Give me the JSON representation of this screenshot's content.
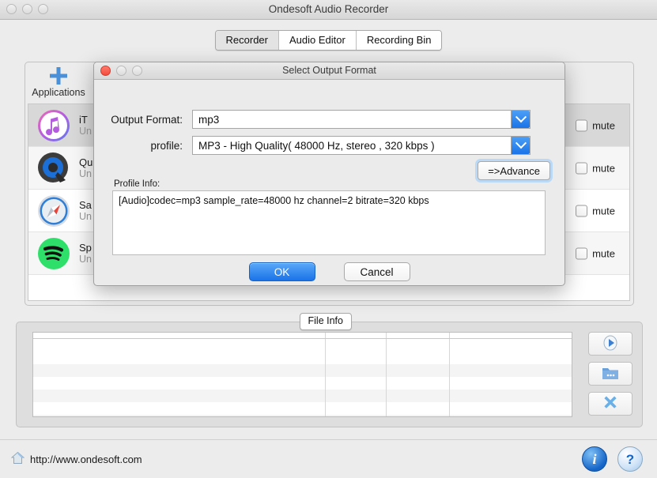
{
  "window": {
    "title": "Ondesoft Audio Recorder",
    "traffic_lights": [
      "close",
      "minimize",
      "zoom"
    ]
  },
  "tabs": [
    {
      "label": "Recorder",
      "selected": true
    },
    {
      "label": "Audio Editor",
      "selected": false
    },
    {
      "label": "Recording Bin",
      "selected": false
    }
  ],
  "toolbar": {
    "add": {
      "label": "Applications",
      "icon": "plus-icon"
    },
    "delete": {
      "label": "",
      "icon": "x-delete-icon"
    },
    "schedule": {
      "label": "",
      "icon": "clock-icon"
    }
  },
  "app_list": {
    "mute_label": "mute",
    "rows": [
      {
        "name": "iT",
        "status": "Un",
        "icon": "itunes-icon",
        "muted": false,
        "selected": true
      },
      {
        "name": "Qu",
        "status": "Un",
        "icon": "quicktime-icon",
        "muted": false,
        "selected": false
      },
      {
        "name": "Sa",
        "status": "Un",
        "icon": "safari-icon",
        "muted": false,
        "selected": false
      },
      {
        "name": "Sp",
        "status": "Un",
        "icon": "spotify-icon",
        "muted": false,
        "selected": false
      }
    ]
  },
  "file_info": {
    "legend": "File Info",
    "columns": [
      "",
      "",
      "",
      ""
    ],
    "rows": [],
    "buttons": [
      {
        "name": "play",
        "icon": "play-icon"
      },
      {
        "name": "open-folder",
        "icon": "folder-icon"
      },
      {
        "name": "remove",
        "icon": "x-delete-icon"
      }
    ]
  },
  "status_bar": {
    "home_icon": "home-icon",
    "url": "http://www.ondesoft.com",
    "info_label": "i",
    "help_label": "?"
  },
  "dialog": {
    "title": "Select Output Format",
    "output_format": {
      "label": "Output Format:",
      "value": "mp3"
    },
    "profile": {
      "label": "profile:",
      "value": "MP3 - High Quality( 48000 Hz, stereo , 320 kbps  )"
    },
    "advance_button": "=>Advance",
    "profile_info": {
      "label": "Profile Info:",
      "text": "[Audio]codec=mp3 sample_rate=48000 hz channel=2 bitrate=320 kbps"
    },
    "ok_button": "OK",
    "cancel_button": "Cancel"
  },
  "colors": {
    "accent_blue": "#1a73e8",
    "window_bg": "#ececec",
    "selected_row": "#d8d8d8"
  }
}
